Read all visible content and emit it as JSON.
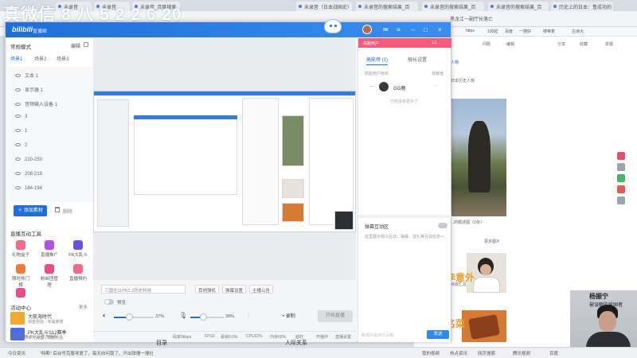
{
  "browser": {
    "tabs": [
      "未录音",
      "未录音",
      "未录音_百度搜索",
      "未录音（日本战国史）",
      "未录音的搜索结果_百",
      "未录音的搜索结果_百",
      "未录音的搜索结果_百",
      "搜索结果_百",
      "历史上的日本：鲁成功的"
    ],
    "bookmarks": [
      "https",
      "100起",
      "百度",
      "一搜好",
      "搜帝复",
      "古诗大"
    ],
    "addr_hint": "黑龙江一副厅长落亡"
  },
  "app": {
    "logo": "bilibili",
    "title": "直播姬",
    "left": {
      "scene_mode": "常规模式",
      "edit": "编辑",
      "scene_tabs": [
        "场景1",
        "场景2",
        "场景3"
      ],
      "sources": [
        "文本 1",
        "显示器 1",
        "音频输入设备 1",
        "3",
        "1",
        "2",
        "220-250",
        "208-219",
        "184-194"
      ],
      "add_source": "添加素材",
      "delete": "删除",
      "tools_title": "直播互动工具",
      "tools": [
        {
          "label": "礼物盒子",
          "color": "#f06a8a"
        },
        {
          "label": "直播推广",
          "color": "#b44ee8"
        },
        {
          "label": "PK大乱斗",
          "color": "#6a4ee8"
        },
        {
          "label": "限时热门榜",
          "color": "#f07a3a"
        },
        {
          "label": "粉丝团管理",
          "color": "#e84e8a"
        },
        {
          "label": "直播预约",
          "color": "#f06a8a"
        },
        {
          "label": "",
          "color": "#e84e8a"
        }
      ],
      "activity_title": "活动中心",
      "activity_more": "更多",
      "activities": [
        {
          "title": "大航海时代",
          "sub": "现金奖励 · 专属荣誉"
        },
        {
          "title": "PK大乱斗S12赛季",
          "sub": "荣光战里 · 现金奖励"
        }
      ]
    },
    "controls": {
      "title_placeholder": "三国志11PK2.2历史科技",
      "pills": [
        "其他弹机",
        "弹幕设置",
        "主播公告"
      ],
      "preview_label": "预览",
      "mic_volume": "37%",
      "speaker_volume": "39%",
      "mic_level": 0.37,
      "speaker_level": 0.39,
      "record": "录制",
      "start_live": "开始直播",
      "stats": [
        "码率0kbps",
        "FPS0",
        "丢帧0.0%",
        "CPU32%",
        "内存60%",
        "延时",
        "开播中",
        "直播设置"
      ],
      "uid": "bilibili直播 个人认证开播中"
    },
    "right": {
      "header_left": "高能用户",
      "header_right": "1/1",
      "tabs": [
        "高能榜 (1)",
        "舰长设置"
      ],
      "sub_left": "高能用户榜单",
      "sub_right": "贡献值",
      "user": {
        "rank": "—",
        "name": "GG鹿",
        "more": "···"
      },
      "no_more": "已经没有更多了",
      "interact_title": "弹幕互动区",
      "interact_desc": "这里展示观众互动、弹幕、送礼等互动信息～",
      "input_placeholder": "和观众说点什么吧",
      "send": "发送"
    }
  },
  "webpage": {
    "texts": [
      "问题",
      "编辑",
      "分享",
      "收藏",
      "举报",
      "人物",
      "日本历史人物",
      "...的概述图（2张）",
      "更多图片",
      "李意外",
      "点底汇总",
      "名菜"
    ],
    "streamer_name": "杨振宁",
    "streamer_sub": "被误解的爱国者"
  },
  "taskbar": [
    "今日资讯",
    "\"特斯\" 后台号克服寻爱了，每天向问我了，开出铁搜一搜社",
    "目录",
    "人际关系",
    "我的视频",
    "热点资讯",
    "网页搜索",
    "腾讯视频",
    "百度"
  ],
  "watermark": "真微信 8 八 5 2 2 6 20"
}
